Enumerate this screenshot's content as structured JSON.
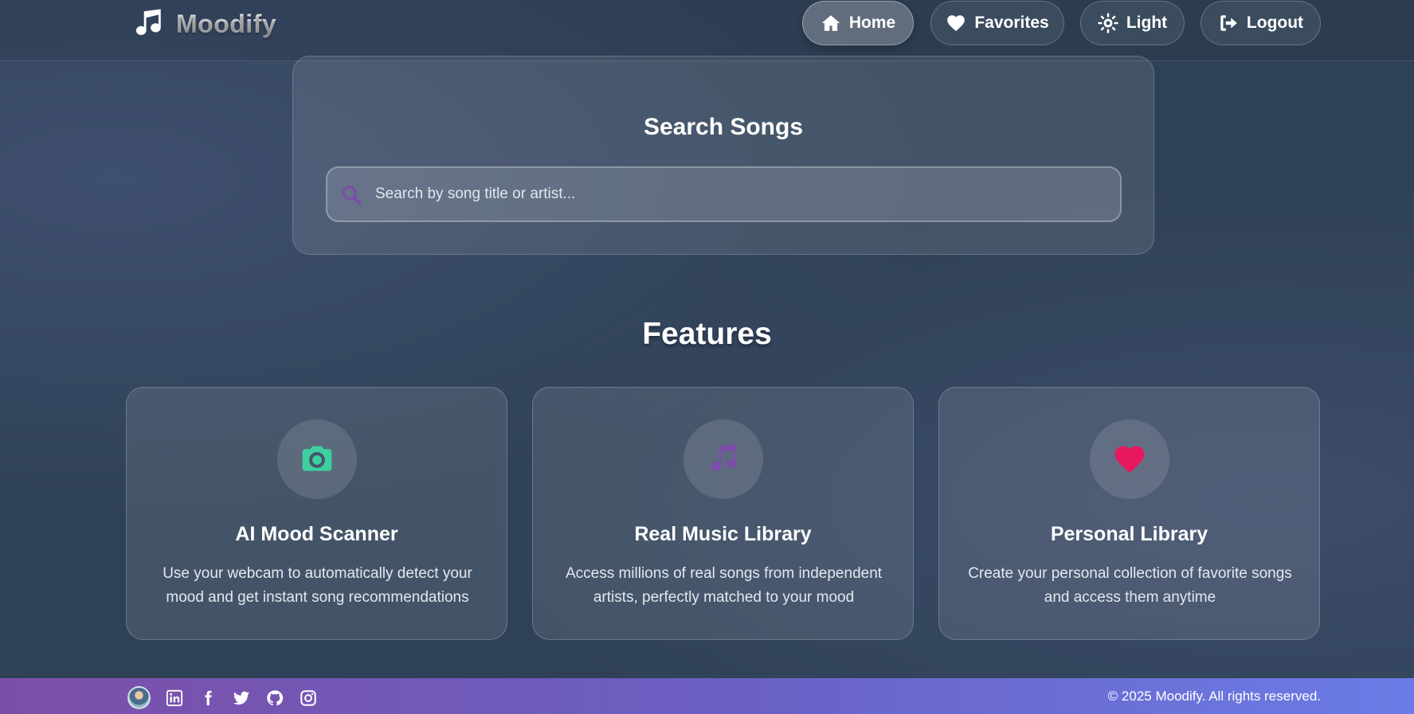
{
  "brand": {
    "name": "Moodify",
    "icon": "music-note-icon"
  },
  "nav": {
    "home": {
      "label": "Home",
      "icon": "home-icon",
      "active": true
    },
    "favorites": {
      "label": "Favorites",
      "icon": "heart-icon"
    },
    "theme": {
      "label": "Light",
      "icon": "sun-icon"
    },
    "logout": {
      "label": "Logout",
      "icon": "logout-icon"
    }
  },
  "search": {
    "title": "Search Songs",
    "placeholder": "Search by song title or artist...",
    "value": "",
    "icon": "search-icon"
  },
  "features": {
    "title": "Features",
    "items": [
      {
        "title": "AI Mood Scanner",
        "description": "Use your webcam to automatically detect your mood and get instant song recommendations",
        "icon": "camera-icon",
        "icon_color": "#3ecf9f"
      },
      {
        "title": "Real Music Library",
        "description": "Access millions of real songs from independent artists, perfectly matched to your mood",
        "icon": "music-note-icon",
        "icon_color": "#7b4fa8"
      },
      {
        "title": "Personal Library",
        "description": "Create your personal collection of favorite songs and access them anytime",
        "icon": "heart-icon",
        "icon_color": "#e8185f"
      }
    ]
  },
  "footer": {
    "social": [
      {
        "icon": "avatar"
      },
      {
        "icon": "linkedin-icon"
      },
      {
        "icon": "facebook-icon"
      },
      {
        "icon": "twitter-icon"
      },
      {
        "icon": "github-icon"
      },
      {
        "icon": "instagram-icon"
      }
    ],
    "copyright": "© 2025 Moodify. All rights reserved."
  },
  "colors": {
    "background": "#2f4157",
    "footer_gradient_start": "#7b4fa8",
    "footer_gradient_end": "#6b7ce6",
    "search_icon": "#7b4fa8"
  }
}
